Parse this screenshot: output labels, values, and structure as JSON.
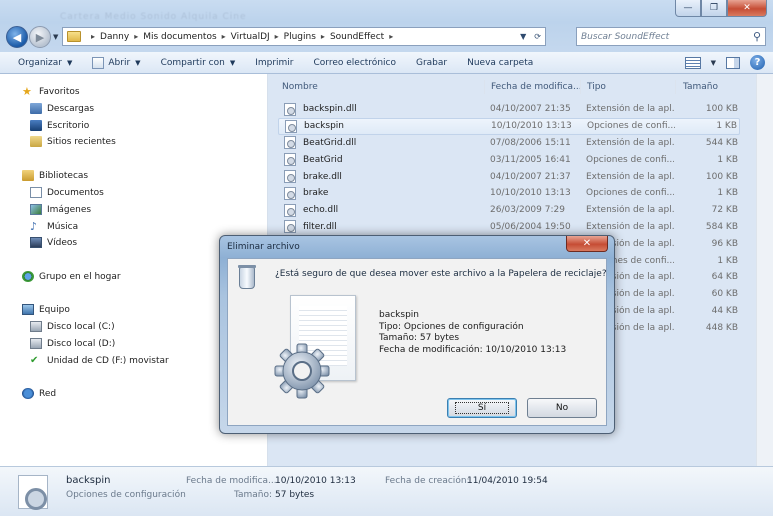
{
  "window": {
    "blurred_text": "Cartera      Medio Sonido      Alquila Cine"
  },
  "caption_buttons": {
    "minimize": "—",
    "maximize": "❐",
    "close": "✕"
  },
  "address": {
    "crumbs": [
      "Danny",
      "Mis documentos",
      "VirtualDJ",
      "Plugins",
      "SoundEffect"
    ],
    "search_placeholder": "Buscar SoundEffect"
  },
  "toolbar": {
    "organize": "Organizar",
    "open": "Abrir",
    "share": "Compartir con",
    "print": "Imprimir",
    "email": "Correo electrónico",
    "burn": "Grabar",
    "new_folder": "Nueva carpeta",
    "help": "?"
  },
  "sidebar": {
    "favorites": "Favoritos",
    "downloads": "Descargas",
    "desktop": "Escritorio",
    "recent": "Sitios recientes",
    "libraries": "Bibliotecas",
    "documents": "Documentos",
    "images": "Imágenes",
    "music": "Música",
    "videos": "Vídeos",
    "homegroup": "Grupo en el hogar",
    "computer": "Equipo",
    "disk_c": "Disco local (C:)",
    "disk_d": "Disco local (D:)",
    "cd": "Unidad de CD (F:) movistar",
    "network": "Red"
  },
  "columns": {
    "name": "Nombre",
    "date": "Fecha de modifica...",
    "type": "Tipo",
    "size": "Tamaño"
  },
  "files": [
    {
      "name": "backspin.dll",
      "date": "04/10/2007 21:35",
      "type": "Extensión de la apl...",
      "size": "100 KB"
    },
    {
      "name": "backspin",
      "date": "10/10/2010 13:13",
      "type": "Opciones de confi...",
      "size": "1 KB"
    },
    {
      "name": "BeatGrid.dll",
      "date": "07/08/2006 15:11",
      "type": "Extensión de la apl...",
      "size": "544 KB"
    },
    {
      "name": "BeatGrid",
      "date": "03/11/2005 16:41",
      "type": "Opciones de confi...",
      "size": "1 KB"
    },
    {
      "name": "brake.dll",
      "date": "04/10/2007 21:37",
      "type": "Extensión de la apl...",
      "size": "100 KB"
    },
    {
      "name": "brake",
      "date": "10/10/2010 13:13",
      "type": "Opciones de confi...",
      "size": "1 KB"
    },
    {
      "name": "echo.dll",
      "date": "26/03/2009 7:29",
      "type": "Extensión de la apl...",
      "size": "72 KB"
    },
    {
      "name": "filter.dll",
      "date": "05/06/2004 19:50",
      "type": "Extensión de la apl...",
      "size": "584 KB"
    },
    {
      "name": "",
      "date": "",
      "type": "Extensión de la apl...",
      "size": "96 KB"
    },
    {
      "name": "",
      "date": "",
      "type": "Opciones de confi...",
      "size": "1 KB"
    },
    {
      "name": "",
      "date": "",
      "type": "Extensión de la apl...",
      "size": "64 KB"
    },
    {
      "name": "",
      "date": "",
      "type": "Extensión de la apl...",
      "size": "60 KB"
    },
    {
      "name": "",
      "date": "",
      "type": "Extensión de la apl...",
      "size": "44 KB"
    },
    {
      "name": "",
      "date": "",
      "type": "Extensión de la apl...",
      "size": "448 KB"
    }
  ],
  "details": {
    "name": "backspin",
    "type": "Opciones de configuración",
    "modified_label": "Fecha de modifica...",
    "modified_value": "10/10/2010 13:13",
    "created_label": "Fecha de creación:",
    "created_value": "11/04/2010 19:54",
    "size_label": "Tamaño:",
    "size_value": "57 bytes"
  },
  "dialog": {
    "title": "Eliminar archivo",
    "close": "✕",
    "question": "¿Está seguro de que desea mover este archivo a la Papelera de reciclaje?",
    "file_name": "backspin",
    "file_type": "Tipo: Opciones de configuración",
    "file_size": "Tamaño: 57 bytes",
    "file_date": "Fecha de modificación: 10/10/2010 13:13",
    "yes": "Sí",
    "no": "No"
  }
}
